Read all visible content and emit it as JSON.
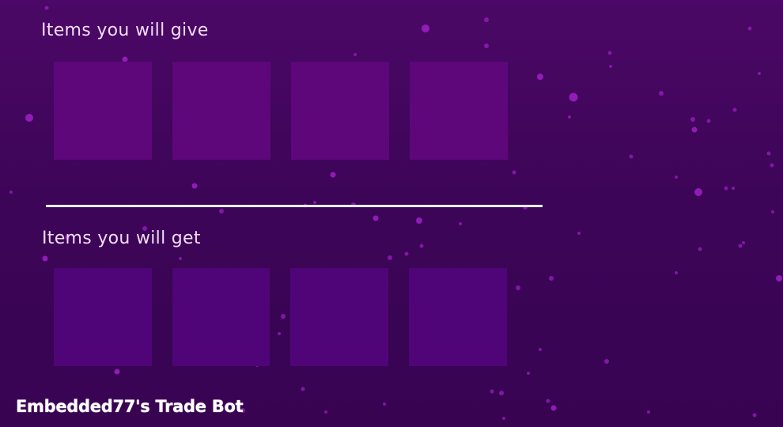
{
  "give_section": {
    "title": "Items you will give",
    "slots": [
      "",
      "",
      "",
      ""
    ]
  },
  "get_section": {
    "title": "Items you will get",
    "slots": [
      "",
      "",
      "",
      ""
    ]
  },
  "footer": {
    "brand": "Embedded77's Trade Bot"
  },
  "colors": {
    "background_top": "#4b0866",
    "background_bottom": "#380452",
    "give_slot": "#5d077a",
    "get_slot": "#4f0577",
    "particle": "#a020c8",
    "divider": "#ffffff",
    "title_text": "#f2dcf5"
  }
}
